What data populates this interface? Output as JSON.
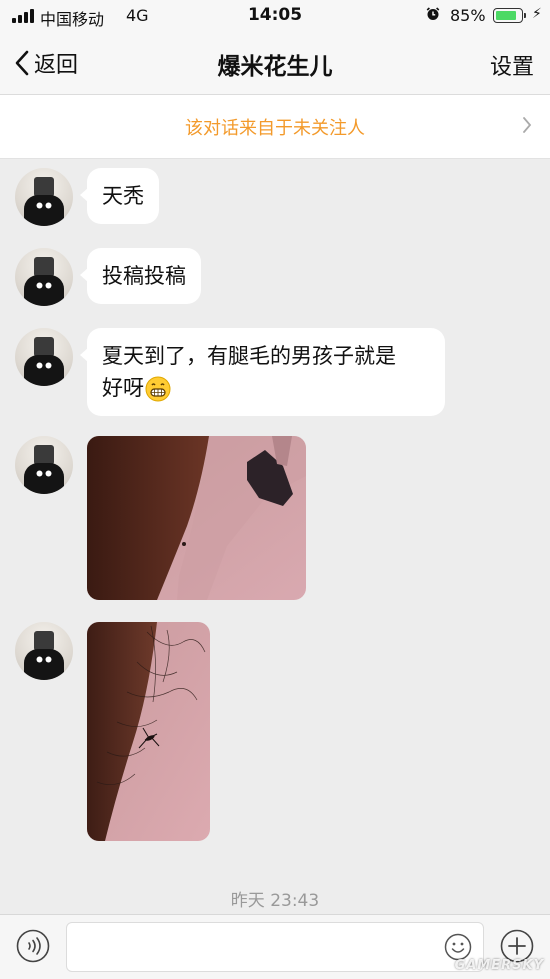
{
  "status_bar": {
    "carrier": "中国移动",
    "network": "4G",
    "time": "14:05",
    "battery_percent": "85%",
    "battery_level": 0.85
  },
  "nav": {
    "back_label": "返回",
    "title": "爆米花生儿",
    "settings_label": "设置"
  },
  "banner": {
    "text": "该对话来自于未关注人"
  },
  "messages": [
    {
      "type": "text",
      "text": "天秃"
    },
    {
      "type": "text",
      "text": "投稿投稿"
    },
    {
      "type": "text",
      "line1": "夏天到了，有腿毛的男孩子就是",
      "line2": "好呀",
      "emoji": "grinning-face-icon"
    },
    {
      "type": "image"
    },
    {
      "type": "image"
    }
  ],
  "timestamp": "昨天 23:43",
  "input": {
    "value": ""
  },
  "watermark": "GAMERSKY",
  "colors": {
    "banner_text": "#f39a2b",
    "battery_fill": "#4cd964",
    "background": "#ededed"
  }
}
